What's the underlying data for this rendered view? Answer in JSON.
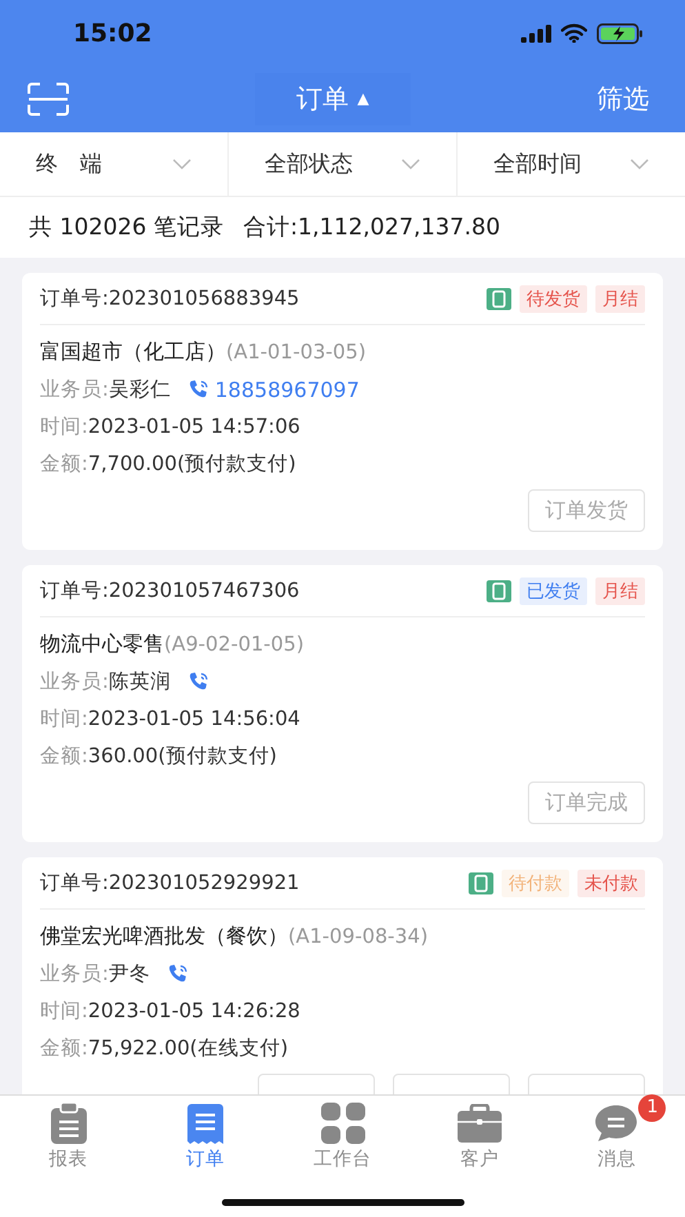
{
  "status_bar": {
    "time": "15:02"
  },
  "header": {
    "title": "订单",
    "title_caret": "▲",
    "filter_button": "筛选"
  },
  "filters": [
    {
      "label": "终　端"
    },
    {
      "label": "全部状态"
    },
    {
      "label": "全部时间"
    }
  ],
  "summary": {
    "count_text": "共 102026 笔记录",
    "total_text": "合计:1,112,027,137.80"
  },
  "orders": [
    {
      "order_no": "订单号:202301056883945",
      "tags": [
        {
          "label": "待发货",
          "color": "#e5534b"
        },
        {
          "label": "月结",
          "color": "#e5534b"
        }
      ],
      "customer": "富国超市（化工店）",
      "code": "(A1-01-03-05)",
      "salesperson_label": "业务员:",
      "salesperson": "吴彩仁",
      "phone": "18858967097",
      "time_label": "时间:",
      "time": "2023-01-05 14:57:06",
      "amount_label": "金额:",
      "amount": "7,700.00(预付款支付)",
      "actions": [
        {
          "kind": "button",
          "label": "订单发货"
        }
      ]
    },
    {
      "order_no": "订单号:202301057467306",
      "tags": [
        {
          "label": "已发货",
          "color": "#3f7ef0"
        },
        {
          "label": "月结",
          "color": "#e5534b"
        }
      ],
      "customer": "物流中心零售",
      "code": "(A9-02-01-05)",
      "salesperson_label": "业务员:",
      "salesperson": "陈英润",
      "time_label": "时间:",
      "time": "2023-01-05 14:56:04",
      "amount_label": "金额:",
      "amount": "360.00(预付款支付)",
      "actions": [
        {
          "kind": "button",
          "label": "订单完成"
        }
      ]
    },
    {
      "order_no": "订单号:202301052929921",
      "tags": [
        {
          "label": "待付款",
          "color": "#f2b37a"
        },
        {
          "label": "未付款",
          "color": "#e5534b"
        }
      ],
      "customer": "佛堂宏光啤酒批发（餐饮）",
      "code": "(A1-09-08-34)",
      "salesperson_label": "业务员:",
      "salesperson": "尹冬",
      "time_label": "时间:",
      "time": "2023-01-05 14:26:28",
      "amount_label": "金额:",
      "amount": "75,922.00(在线支付)",
      "actions": [
        {
          "kind": "covered"
        },
        {
          "kind": "covered"
        },
        {
          "kind": "covered"
        }
      ]
    }
  ],
  "tabbar": [
    {
      "label": "报表",
      "selected": false
    },
    {
      "label": "订单",
      "selected": true
    },
    {
      "label": "工作台",
      "selected": false
    },
    {
      "label": "客户",
      "selected": false
    },
    {
      "label": "消息",
      "selected": false,
      "badge": "1"
    }
  ]
}
